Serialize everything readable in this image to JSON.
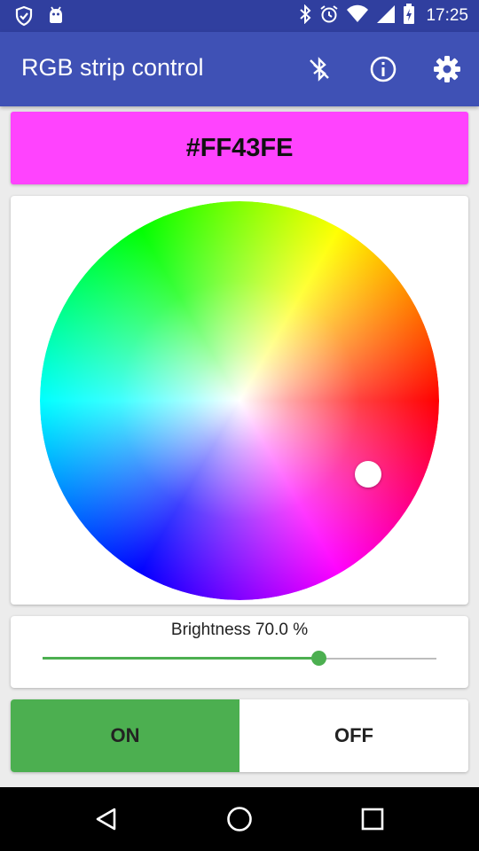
{
  "status_bar": {
    "time": "17:25",
    "left_icons": [
      "shield-check-icon",
      "android-icon"
    ],
    "right_icons": [
      "bluetooth-icon",
      "alarm-icon",
      "wifi-icon",
      "signal-icon",
      "battery-charging-icon"
    ]
  },
  "app_bar": {
    "title": "RGB strip control",
    "actions": [
      "bluetooth-disabled-icon",
      "info-icon",
      "settings-icon"
    ],
    "color": "#3F51B5",
    "status_color": "#303F9F"
  },
  "color_preview": {
    "hex": "#FF43FE",
    "color": "#FF43FE"
  },
  "color_wheel": {
    "selected_color": "#FF43FE"
  },
  "brightness": {
    "label": "Brightness 70.0 %",
    "value": 0.7,
    "accent": "#4CAF50"
  },
  "power": {
    "on_label": "ON",
    "off_label": "OFF",
    "active": "on",
    "active_color": "#4CAF50"
  },
  "nav_bar": {
    "buttons": [
      "back-icon",
      "home-icon",
      "recents-icon"
    ]
  }
}
